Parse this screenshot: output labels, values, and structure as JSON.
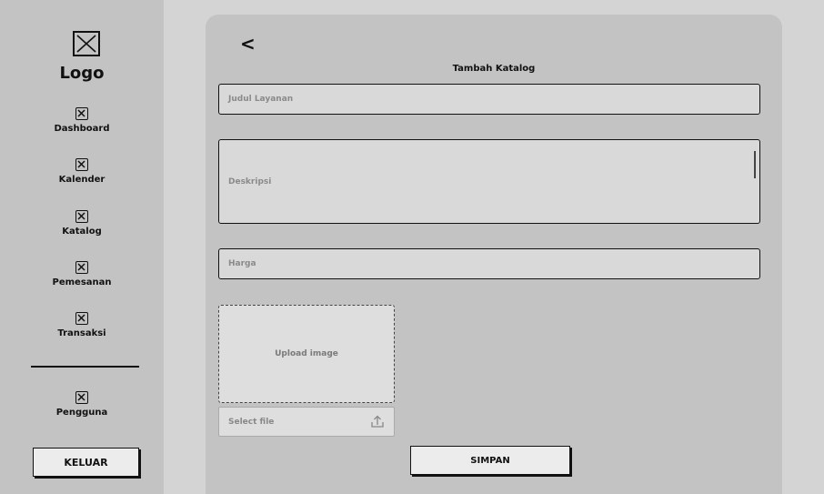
{
  "sidebar": {
    "logo_text": "Logo",
    "items": [
      {
        "label": "Dashboard"
      },
      {
        "label": "Kalender"
      },
      {
        "label": "Katalog"
      },
      {
        "label": "Pemesanan"
      },
      {
        "label": "Transaksi"
      },
      {
        "label": "Pengguna"
      }
    ],
    "logout_label": "KELUAR"
  },
  "main": {
    "back_icon": "<",
    "title": "Tambah Katalog",
    "fields": {
      "title_placeholder": "Judul Layanan",
      "description_placeholder": "Deskripsi",
      "price_placeholder": "Harga"
    },
    "upload": {
      "label": "Upload image",
      "select_file_label": "Select file"
    },
    "save_label": "SIMPAN"
  }
}
